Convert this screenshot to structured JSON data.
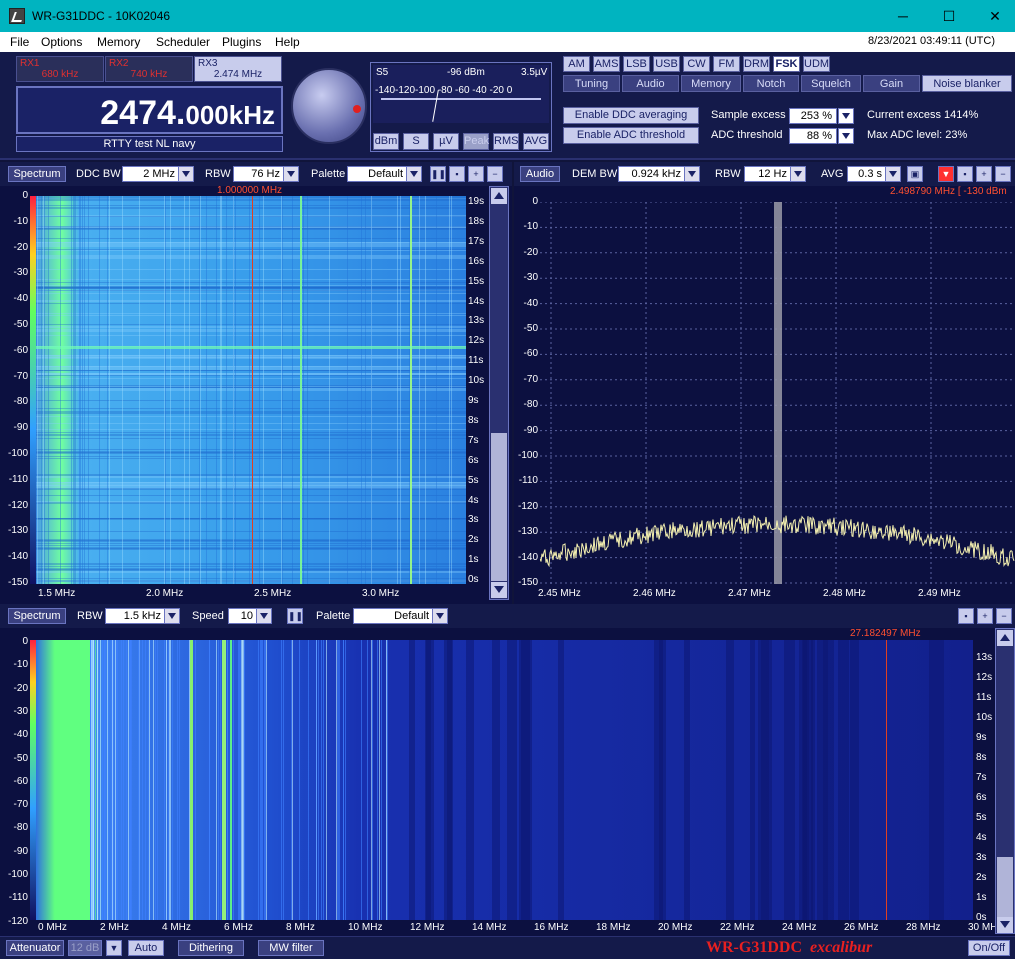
{
  "window": {
    "title": "WR-G31DDC - 10K02046",
    "minimize": "─",
    "maximize": "☐",
    "close": "✕"
  },
  "menu": [
    "File",
    "Options",
    "Memory",
    "Scheduler",
    "Plugins",
    "Help"
  ],
  "clock": "8/23/2021 03:49:11 (UTC)",
  "receivers": [
    {
      "label": "RX1",
      "freq": "680 kHz",
      "active": false
    },
    {
      "label": "RX2",
      "freq": "740 kHz",
      "active": false
    },
    {
      "label": "RX3",
      "freq": "2.474 MHz",
      "active": true
    }
  ],
  "frequency": {
    "main": "2474.",
    "fraction": "000",
    "unit": "kHz"
  },
  "channel_name": "RTTY test NL navy",
  "smeter": {
    "s": "S5",
    "dbm": "-96 dBm",
    "uv": "3.5µV",
    "scale": "-140-120-100 -80 -60 -40 -20   0",
    "buttons": [
      "dBm",
      "S",
      "µV",
      "Peak",
      "RMS",
      "AVG"
    ]
  },
  "modes": [
    "AM",
    "AMS",
    "LSB",
    "USB",
    "CW",
    "FM",
    "DRM",
    "FSK",
    "UDM"
  ],
  "selected_mode": "FSK",
  "tabs": [
    "Tuning",
    "Audio",
    "Memory",
    "Notch",
    "Squelch",
    "Gain",
    "Noise blanker"
  ],
  "selected_tab": "Noise blanker",
  "noise_blanker": {
    "ddc_btn": "Enable DDC averaging",
    "adc_btn": "Enable ADC threshold",
    "sample_excess_label": "Sample excess",
    "sample_excess": "253 %",
    "adc_threshold_label": "ADC threshold",
    "adc_threshold": "88 %",
    "current_excess": "Current excess 1414%",
    "max_adc": "Max ADC level: 23%"
  },
  "ddc_panel": {
    "spectrum_btn": "Spectrum",
    "ddc_bw_label": "DDC BW",
    "ddc_bw": "2 MHz",
    "rbw_label": "RBW",
    "rbw": "76 Hz",
    "palette_label": "Palette",
    "palette": "Default",
    "marker": "1.000000 MHz",
    "y_labels": [
      "0",
      "-10",
      "-20",
      "-30",
      "-40",
      "-50",
      "-60",
      "-70",
      "-80",
      "-90",
      "-100",
      "-110",
      "-120",
      "-130",
      "-140",
      "-150"
    ],
    "t_labels": [
      "19s",
      "18s",
      "17s",
      "16s",
      "15s",
      "14s",
      "13s",
      "12s",
      "11s",
      "10s",
      "9s",
      "8s",
      "7s",
      "6s",
      "5s",
      "4s",
      "3s",
      "2s",
      "1s",
      "0s"
    ],
    "x_labels": [
      "1.5 MHz",
      "2.0 MHz",
      "2.5 MHz",
      "3.0 MHz"
    ]
  },
  "audio_panel": {
    "audio_btn": "Audio",
    "dem_bw_label": "DEM BW",
    "dem_bw": "0.924 kHz",
    "rbw_label": "RBW",
    "rbw": "12 Hz",
    "avg_label": "AVG",
    "avg": "0.3 s",
    "marker": "2.498790 MHz [ -130 dBm",
    "y_labels": [
      "0",
      "-10",
      "-20",
      "-30",
      "-40",
      "-50",
      "-60",
      "-70",
      "-80",
      "-90",
      "-100",
      "-110",
      "-120",
      "-130",
      "-140",
      "-150"
    ],
    "x_labels": [
      "2.45 MHz",
      "2.46 MHz",
      "2.47 MHz",
      "2.48 MHz",
      "2.49 MHz"
    ]
  },
  "wide_panel": {
    "spectrum_btn": "Spectrum",
    "rbw_label": "RBW",
    "rbw": "1.5 kHz",
    "speed_label": "Speed",
    "speed": "10",
    "palette_label": "Palette",
    "palette": "Default",
    "marker": "27.182497 MHz",
    "y_labels": [
      "0",
      "-10",
      "-20",
      "-30",
      "-40",
      "-50",
      "-60",
      "-70",
      "-80",
      "-90",
      "-100",
      "-110",
      "-120"
    ],
    "t_labels": [
      "13s",
      "12s",
      "11s",
      "10s",
      "9s",
      "8s",
      "7s",
      "6s",
      "5s",
      "4s",
      "3s",
      "2s",
      "1s",
      "0s"
    ],
    "x_labels": [
      "0 MHz",
      "2 MHz",
      "4 MHz",
      "6 MHz",
      "8 MHz",
      "10 MHz",
      "12 MHz",
      "14 MHz",
      "16 MHz",
      "18 MHz",
      "20 MHz",
      "22 MHz",
      "24 MHz",
      "26 MHz",
      "28 MHz",
      "30 MHz"
    ]
  },
  "bottom": {
    "attenuator": "Attenuator",
    "attenuator_val": "12 dB",
    "auto": "Auto",
    "dithering": "Dithering",
    "mw_filter": "MW filter",
    "brand": "WR-G31DDC",
    "brand_sub": "excalibur",
    "onoff": "On/Off"
  },
  "colors": {
    "accent": "#c8ccec",
    "panel": "#141a4a",
    "marker": "#ff5030",
    "trace": "#f4f0b0"
  }
}
